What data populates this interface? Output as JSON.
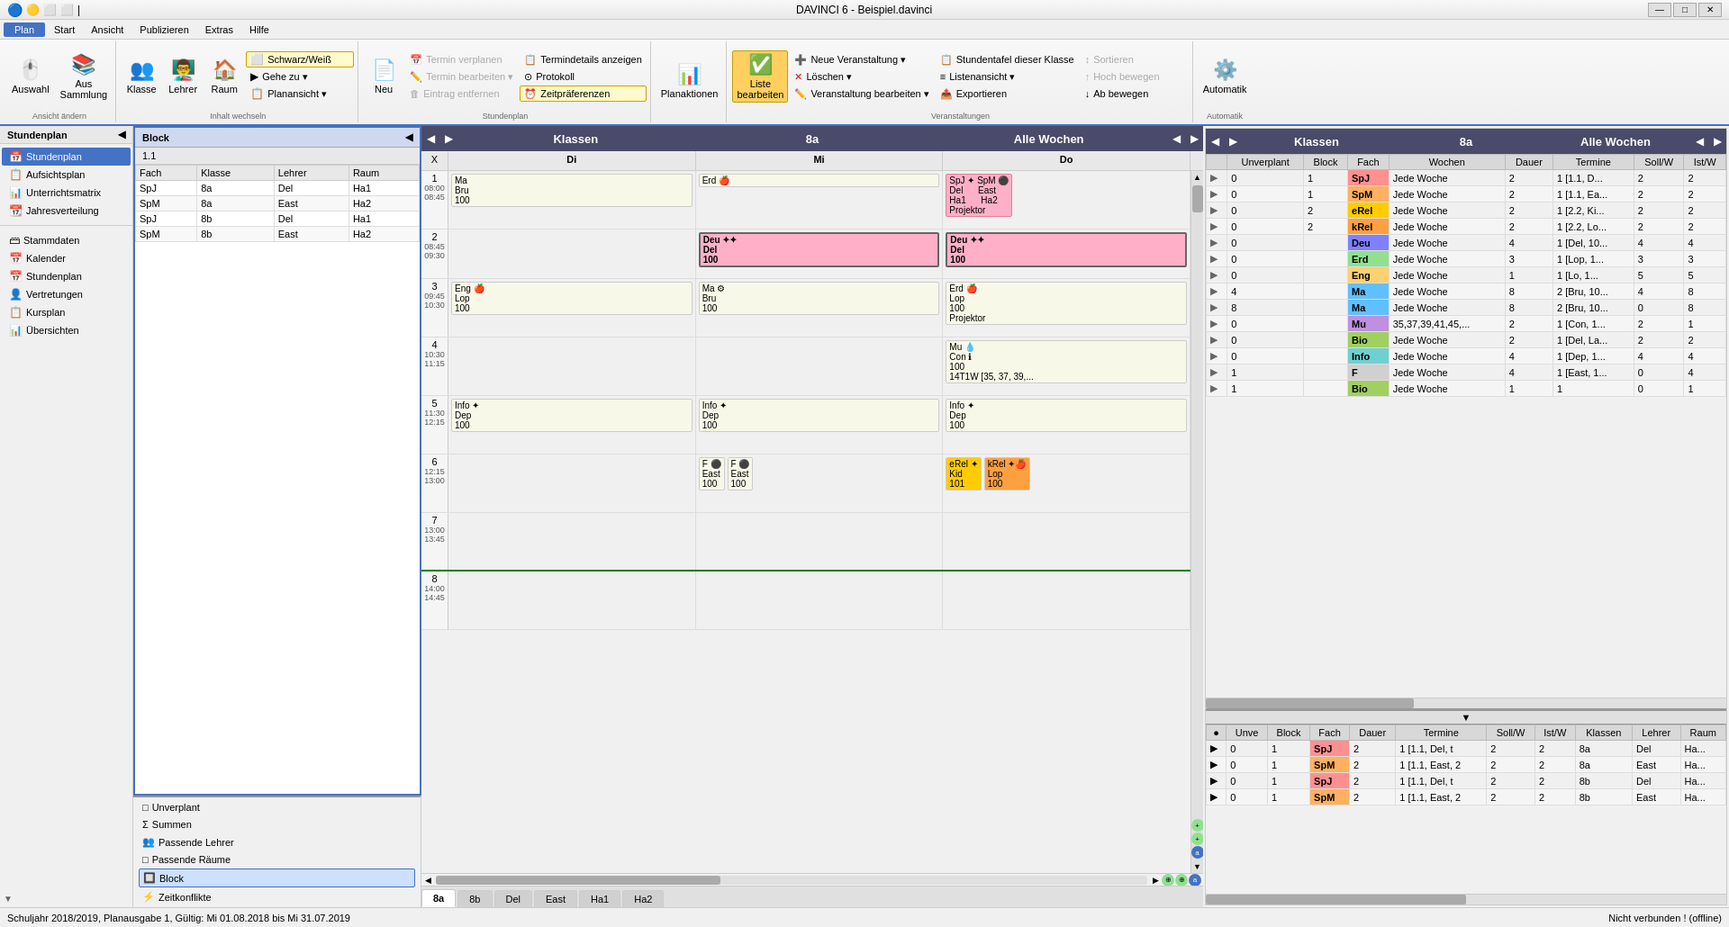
{
  "titlebar": {
    "title": "DAVINCI 6 - Beispiel.davinci",
    "min": "—",
    "max": "□",
    "close": "✕"
  },
  "menubar": {
    "items": [
      "Plan",
      "Start",
      "Ansicht",
      "Publizieren",
      "Extras",
      "Hilfe"
    ]
  },
  "ribbon": {
    "groups": [
      {
        "label": "Ansicht ändern",
        "buttons": [
          "Auswahl",
          "Aus Sammlung"
        ]
      },
      {
        "label": "Inhalt wechseln",
        "buttons": [
          "Klasse",
          "Lehrer",
          "Raum",
          "Schwarz/Weiß",
          "Gehe zu",
          "Planansicht"
        ]
      },
      {
        "label": "Stundenplan",
        "buttons": [
          "Neu",
          "Termin verplanen",
          "Termin bearbeiten",
          "Eintrag entfernen",
          "Termindetails anzeigen",
          "Protokoll",
          "Zeitpräferenzen"
        ]
      },
      {
        "label": "",
        "buttons": [
          "Planaktionen"
        ]
      },
      {
        "label": "Veranstaltungen",
        "buttons": [
          "Neue Veranstaltung",
          "Löschen",
          "Veranstaltung bearbeiten",
          "Liste bearbeiten",
          "Stundentafel dieser Klasse",
          "Listenansicht",
          "Exportieren",
          "Sortieren",
          "Hoch bewegen",
          "Ab bewegen"
        ]
      },
      {
        "label": "Automatik",
        "buttons": [
          "Automatik"
        ]
      }
    ]
  },
  "left_nav": {
    "top_items": [
      {
        "label": "Stundenplan",
        "icon": "📅",
        "active": true
      },
      {
        "label": "Aufsichtsplan",
        "icon": "📋"
      },
      {
        "label": "Unterrichtsmatrix",
        "icon": "📊"
      },
      {
        "label": "Jahresverteilung",
        "icon": "📆"
      }
    ],
    "bottom_items": [
      {
        "label": "Stammdaten",
        "icon": "🗃"
      },
      {
        "label": "Kalender",
        "icon": "📅"
      },
      {
        "label": "Stundenplan",
        "icon": "📅"
      },
      {
        "label": "Vertretungen",
        "icon": "👤"
      },
      {
        "label": "Kursplan",
        "icon": "📋"
      },
      {
        "label": "Übersichten",
        "icon": "📊"
      }
    ],
    "right_items": [
      {
        "label": "Unverplant",
        "icon": "□"
      },
      {
        "label": "Summen",
        "icon": "Σ"
      },
      {
        "label": "Passende Lehrer",
        "icon": "👥"
      },
      {
        "label": "Passende Räume",
        "icon": "🏠"
      },
      {
        "label": "Block",
        "icon": "🔲",
        "selected": true
      },
      {
        "label": "Zeitkonflikte",
        "icon": "⚡"
      }
    ]
  },
  "block_panel": {
    "title": "Block",
    "number": "1.1",
    "columns": [
      "Fach",
      "Klasse",
      "Lehrer",
      "Raum"
    ],
    "rows": [
      {
        "fach": "SpJ",
        "klasse": "8a",
        "lehrer": "Del",
        "raum": "Ha1"
      },
      {
        "fach": "SpM",
        "klasse": "8a",
        "lehrer": "East",
        "raum": "Ha2"
      },
      {
        "fach": "SpJ",
        "klasse": "8b",
        "lehrer": "Del",
        "raum": "Ha1"
      },
      {
        "fach": "SpM",
        "klasse": "8b",
        "lehrer": "East",
        "raum": "Ha2"
      }
    ]
  },
  "timetable_left": {
    "title": "Klassen",
    "subtitle": "8a",
    "week": "Alle Wochen",
    "columns": [
      "X",
      "Di",
      "Mi",
      "Do"
    ],
    "rows": [
      {
        "num": "1",
        "time_start": "08:00",
        "time_end": "08:45",
        "cells": {
          "di": {
            "subject": "Ma",
            "teacher": "Bru",
            "room": "100"
          },
          "mi": {
            "subject": "Erd",
            "icon": "🍎",
            "teacher": "",
            "room": ""
          },
          "do": {
            "subject1": "SpJ",
            "subject2": "SpM",
            "teacher1": "Del",
            "teacher2": "East",
            "room1": "Ha1",
            "room2": "Ha2",
            "has_icons": true,
            "note": "Projektor"
          }
        }
      },
      {
        "num": "2",
        "time_start": "08:45",
        "time_end": "09:30",
        "cells": {
          "di": {},
          "mi": {
            "subject": "Deu",
            "teacher": "Del",
            "room": "100",
            "bold": true
          },
          "do": {
            "subject": "Deu",
            "teacher": "Del",
            "room": "100",
            "bold": true
          }
        }
      },
      {
        "num": "3",
        "time_start": "09:45",
        "time_end": "10:30",
        "cells": {
          "di": {
            "subject": "Eng",
            "icon": "🍎",
            "teacher": "Lop",
            "room": "100"
          },
          "mi": {
            "subject": "Ma",
            "teacher": "Bru",
            "room": "100",
            "icon2": "⚙"
          },
          "do": {
            "subject": "Erd",
            "icon": "🍎",
            "teacher": "Lop",
            "room": "100",
            "note": "Projektor"
          }
        }
      },
      {
        "num": "4",
        "time_start": "10:30",
        "time_end": "11:15",
        "cells": {
          "di": {},
          "mi": {},
          "do": {
            "subject": "Mu",
            "teacher": "Con",
            "room": "100",
            "note": "14T1W [35, 37, 39,...",
            "icon": "💧"
          }
        }
      },
      {
        "num": "5",
        "time_start": "11:30",
        "time_end": "12:15",
        "cells": {
          "di": {
            "subject": "Info",
            "teacher": "Dep",
            "room": "100",
            "icons": "✦"
          },
          "mi": {
            "subject": "Info",
            "teacher": "Dep",
            "room": "100",
            "icons": "✦"
          },
          "do": {
            "subject": "Info",
            "teacher": "Dep",
            "room": "100",
            "icons": "✦"
          }
        }
      },
      {
        "num": "6",
        "time_start": "12:15",
        "time_end": "13:00",
        "cells": {
          "di": {},
          "mi": {
            "subject1": "F",
            "subject2": "F",
            "teacher1": "East",
            "teacher2": "East",
            "room1": "100",
            "room2": "100",
            "icons": "⚫⚫"
          },
          "do": {
            "subject1": "eRel",
            "subject2": "kRel",
            "teacher1": "Kid",
            "teacher2": "Lop",
            "room1": "101",
            "room2": "100",
            "icons": "✦🍎"
          }
        }
      },
      {
        "num": "7",
        "time_start": "13:00",
        "time_end": "13:45",
        "cells": {
          "di": {},
          "mi": {},
          "do": {}
        }
      },
      {
        "num": "8",
        "time_start": "14:00",
        "time_end": "14:45",
        "cells": {
          "di": {},
          "mi": {},
          "do": {}
        }
      }
    ],
    "tabs": [
      "8a",
      "8b",
      "Del",
      "East",
      "Ha1",
      "Ha2"
    ]
  },
  "timetable_right_top": {
    "title": "Klassen",
    "subtitle": "8a",
    "week": "Alle Wochen",
    "columns": [
      "Unverplant",
      "Block",
      "Fach",
      "Wochen",
      "Dauer",
      "Termine",
      "Soll/W",
      "Ist/W"
    ],
    "rows": [
      {
        "unverplant": "0",
        "block": "1",
        "fach": "SpJ",
        "fach_color": "spj",
        "wochen": "Jede Woche",
        "dauer": "2",
        "termine": "1 [1.1, D...",
        "soll": "2",
        "ist": "2"
      },
      {
        "unverplant": "0",
        "block": "1",
        "fach": "SpM",
        "fach_color": "spm",
        "wochen": "Jede Woche",
        "dauer": "2",
        "termine": "1 [1.1, Ea...",
        "soll": "2",
        "ist": "2"
      },
      {
        "unverplant": "0",
        "block": "2",
        "fach": "eRel",
        "fach_color": "erel",
        "wochen": "Jede Woche",
        "dauer": "2",
        "termine": "1 [2.2, Ki...",
        "soll": "2",
        "ist": "2"
      },
      {
        "unverplant": "0",
        "block": "2",
        "fach": "kRel",
        "fach_color": "krel",
        "wochen": "Jede Woche",
        "dauer": "2",
        "termine": "1 [2.2, Lo...",
        "soll": "2",
        "ist": "2"
      },
      {
        "unverplant": "0",
        "block": "",
        "fach": "Deu",
        "fach_color": "deu",
        "wochen": "Jede Woche",
        "dauer": "4",
        "termine": "1 [Del, 10...",
        "soll": "4",
        "ist": "4"
      },
      {
        "unverplant": "0",
        "block": "",
        "fach": "Erd",
        "fach_color": "erd",
        "wochen": "Jede Woche",
        "dauer": "3",
        "termine": "1 [Lop, 1...",
        "soll": "3",
        "ist": "3"
      },
      {
        "unverplant": "0",
        "block": "",
        "fach": "Eng",
        "fach_color": "eng",
        "wochen": "Jede Woche",
        "dauer": "1",
        "termine": "1 [Lo, 1...",
        "soll": "5",
        "ist": "5"
      },
      {
        "unverplant": "4",
        "block": "",
        "fach": "Ma",
        "fach_color": "ma",
        "wochen": "Jede Woche",
        "dauer": "8",
        "termine": "2 [Bru, 10...",
        "soll": "4",
        "ist": "8"
      },
      {
        "unverplant": "8",
        "block": "",
        "fach": "Ma",
        "fach_color": "ma",
        "wochen": "Jede Woche",
        "dauer": "8",
        "termine": "2 [Bru, 10...",
        "soll": "0",
        "ist": "8"
      },
      {
        "unverplant": "0",
        "block": "",
        "fach": "Mu",
        "fach_color": "mu",
        "wochen": "35,37,39,41,45,...",
        "dauer": "2",
        "termine": "1 [Con, 1...",
        "soll": "2",
        "ist": "1"
      },
      {
        "unverplant": "0",
        "block": "",
        "fach": "Bio",
        "fach_color": "bio",
        "wochen": "Jede Woche",
        "dauer": "2",
        "termine": "1 [Del, La...",
        "soll": "2",
        "ist": "2"
      },
      {
        "unverplant": "0",
        "block": "",
        "fach": "Info",
        "fach_color": "info",
        "wochen": "Jede Woche",
        "dauer": "4",
        "termine": "1 [Dep, 1...",
        "soll": "4",
        "ist": "4"
      },
      {
        "unverplant": "1",
        "block": "",
        "fach": "F",
        "fach_color": "f-cell",
        "wochen": "Jede Woche",
        "dauer": "4",
        "termine": "1 [East, 1...",
        "soll": "0",
        "ist": "4"
      },
      {
        "unverplant": "1",
        "block": "",
        "fach": "Bio",
        "fach_color": "bio",
        "wochen": "Jede Woche",
        "dauer": "1",
        "termine": "1",
        "soll": "0",
        "ist": "1"
      }
    ]
  },
  "timetable_right_bottom": {
    "columns": [
      "Unve",
      "Block",
      "Fach",
      "Dauer",
      "Termine",
      "Soll/W",
      "Ist/W",
      "Klassen",
      "Lehrer",
      "Raum"
    ],
    "rows": [
      {
        "unve": "0",
        "block": "1",
        "fach": "SpJ",
        "fach_color": "spj",
        "dauer": "2",
        "termine": "1 [1.1, Del, t",
        "soll": "2",
        "ist": "2",
        "klassen": "8a",
        "lehrer": "Del",
        "raum": "Ha..."
      },
      {
        "unve": "0",
        "block": "1",
        "fach": "SpM",
        "fach_color": "spm",
        "dauer": "2",
        "termine": "1 [1.1, East, 2",
        "soll": "2",
        "ist": "2",
        "klassen": "8a",
        "lehrer": "East",
        "raum": "Ha..."
      },
      {
        "unve": "0",
        "block": "1",
        "fach": "SpJ",
        "fach_color": "spj",
        "dauer": "2",
        "termine": "1 [1.1, Del, t",
        "soll": "2",
        "ist": "2",
        "klassen": "8b",
        "lehrer": "Del",
        "raum": "Ha..."
      },
      {
        "unve": "0",
        "block": "1",
        "fach": "SpM",
        "fach_color": "spm",
        "dauer": "2",
        "termine": "1 [1.1, East, 2",
        "soll": "2",
        "ist": "2",
        "klassen": "8b",
        "lehrer": "East",
        "raum": "Ha..."
      }
    ]
  },
  "statusbar": {
    "left": "Schuljahr 2018/2019, Planausgabe 1, Gültig: Mi 01.08.2018 bis Mi 31.07.2019",
    "right": "Nicht verbunden ! (offline)"
  }
}
